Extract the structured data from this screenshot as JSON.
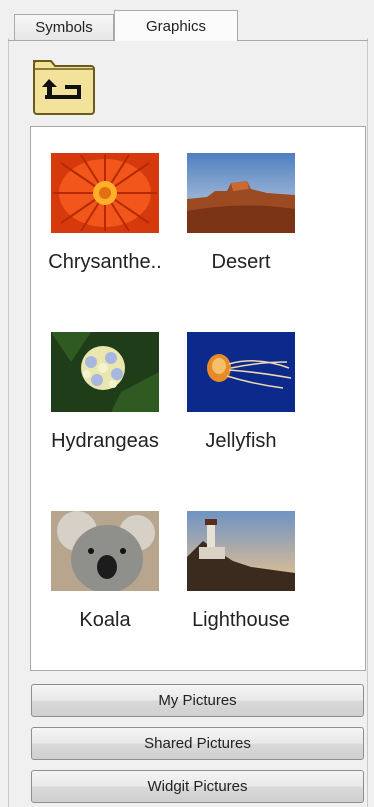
{
  "tabs": [
    {
      "label": "Symbols",
      "active": false
    },
    {
      "label": "Graphics",
      "active": true
    }
  ],
  "toolbar": {
    "up_icon": "folder-up-arrow-icon"
  },
  "gallery": {
    "items": [
      {
        "label": "Chrysanthe..",
        "thumbnail": "chrysanthemum"
      },
      {
        "label": "Desert",
        "thumbnail": "desert"
      },
      {
        "label": "Hydrangeas",
        "thumbnail": "hydrangeas"
      },
      {
        "label": "Jellyfish",
        "thumbnail": "jellyfish"
      },
      {
        "label": "Koala",
        "thumbnail": "koala"
      },
      {
        "label": "Lighthouse",
        "thumbnail": "lighthouse"
      }
    ]
  },
  "folders": [
    {
      "label": "My Pictures"
    },
    {
      "label": "Shared Pictures"
    },
    {
      "label": "Widgit Pictures"
    }
  ],
  "colors": {
    "folder_fill": "#f3e29a",
    "folder_border": "#6b5a1e"
  }
}
